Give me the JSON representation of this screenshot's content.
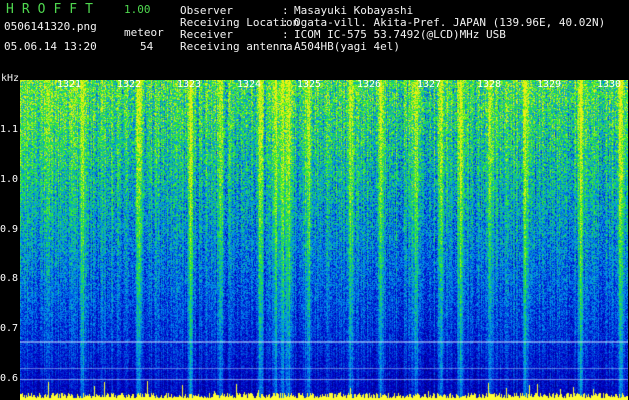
{
  "header": {
    "title": "HROFFT",
    "version": "1.00",
    "filename": "0506141320.png",
    "meteor_label": "meteor",
    "meteor_count": "54",
    "datetime": "05.06.14 13:20"
  },
  "info": [
    {
      "label": "Observer",
      "sep": ":",
      "value": "Masayuki Kobayashi"
    },
    {
      "label": "Receiving Location",
      "sep": ":",
      "value": "Ogata-vill. Akita-Pref. JAPAN (139.96E, 40.02N)"
    },
    {
      "label": "Receiver",
      "sep": ":",
      "value": "ICOM IC-575 53.7492(@LCD)MHz USB"
    },
    {
      "label": "Receiving antenna",
      "sep": ":",
      "value": "A504HB(yagi 4el)"
    }
  ],
  "axis": {
    "y_unit": "kHz",
    "y_ticks": [
      "1.1",
      "1.0",
      "0.9",
      "0.8",
      "0.7",
      "0.6"
    ],
    "time_ticks": [
      "1321",
      "1322",
      "1323",
      "1324",
      "1325",
      "1326",
      "1327",
      "1328",
      "1329",
      "1330"
    ]
  },
  "colors": {
    "background": "#000000",
    "header_green": "#4fd84f",
    "text_white": "#f2f2f2",
    "meteor_yellow": "#ffff33"
  }
}
